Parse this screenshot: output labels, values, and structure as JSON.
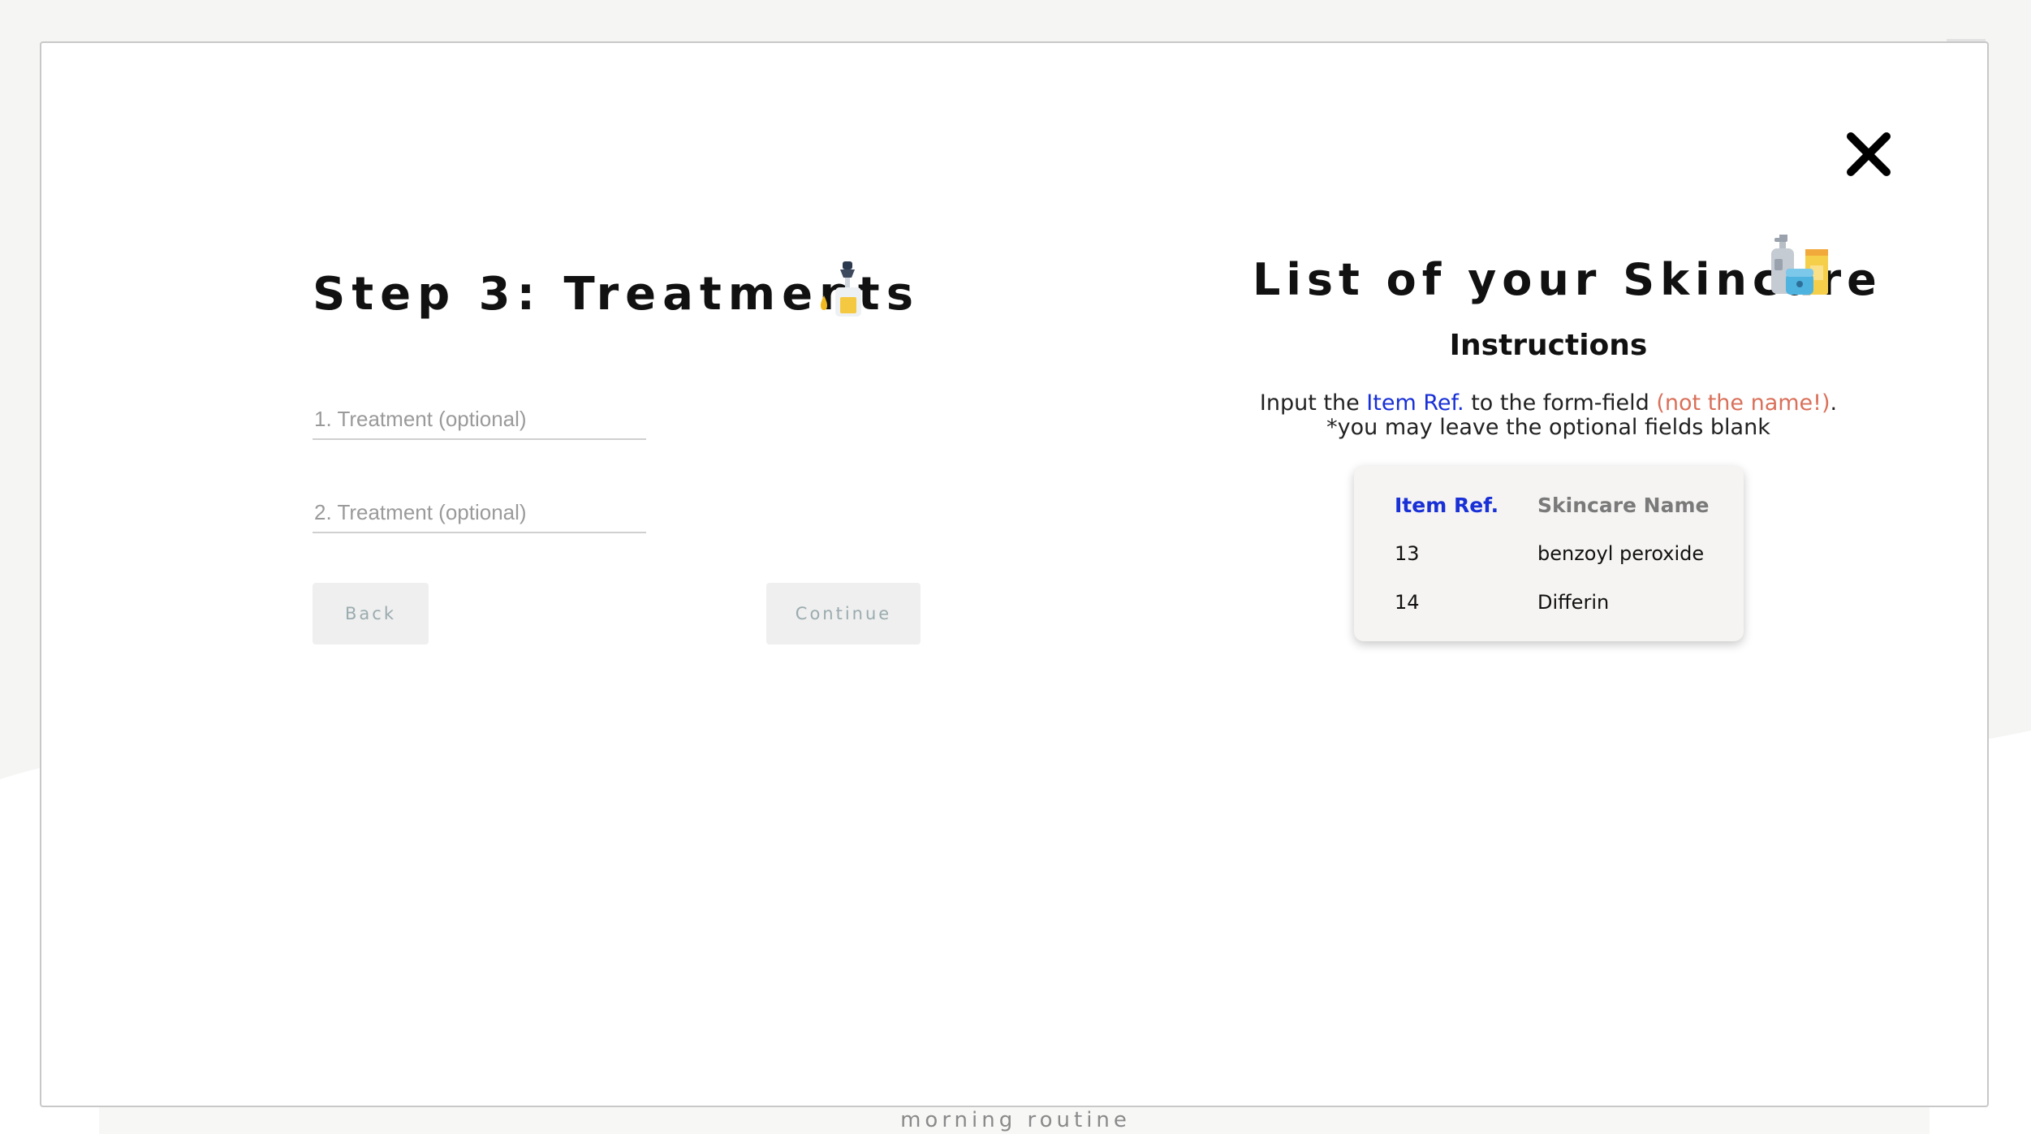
{
  "form": {
    "title": "Step 3: Treatments",
    "step_icon": "serum-dropper-icon",
    "fields": [
      {
        "placeholder": "1. Treatment (optional)",
        "value": ""
      },
      {
        "placeholder": "2. Treatment (optional)",
        "value": ""
      }
    ],
    "back_label": "Back",
    "continue_label": "Continue"
  },
  "skincare_panel": {
    "title": "List of your Skincare",
    "title_icon": "skincare-products-icon",
    "instructions_heading": "Instructions",
    "instruction_prefix": "Input the",
    "instruction_highlight": "Item Ref.",
    "instruction_middle": "to the form-field",
    "instruction_warning": "(not the name!)",
    "instruction_suffix": ".",
    "instruction_note": "*you may leave the optional fields blank",
    "table": {
      "headers": [
        "Item Ref.",
        "Skincare Name"
      ],
      "rows": [
        [
          "13",
          "benzoyl peroxide"
        ],
        [
          "14",
          "Differin"
        ]
      ]
    }
  },
  "footer": {
    "label": "morning routine"
  },
  "icons": {
    "close": "close-icon",
    "corner": "menu-icon"
  },
  "colors": {
    "accent_blue": "#1830d6",
    "warning_red": "#d9705a",
    "button_bg": "#efefef",
    "button_text": "#9aabae"
  }
}
